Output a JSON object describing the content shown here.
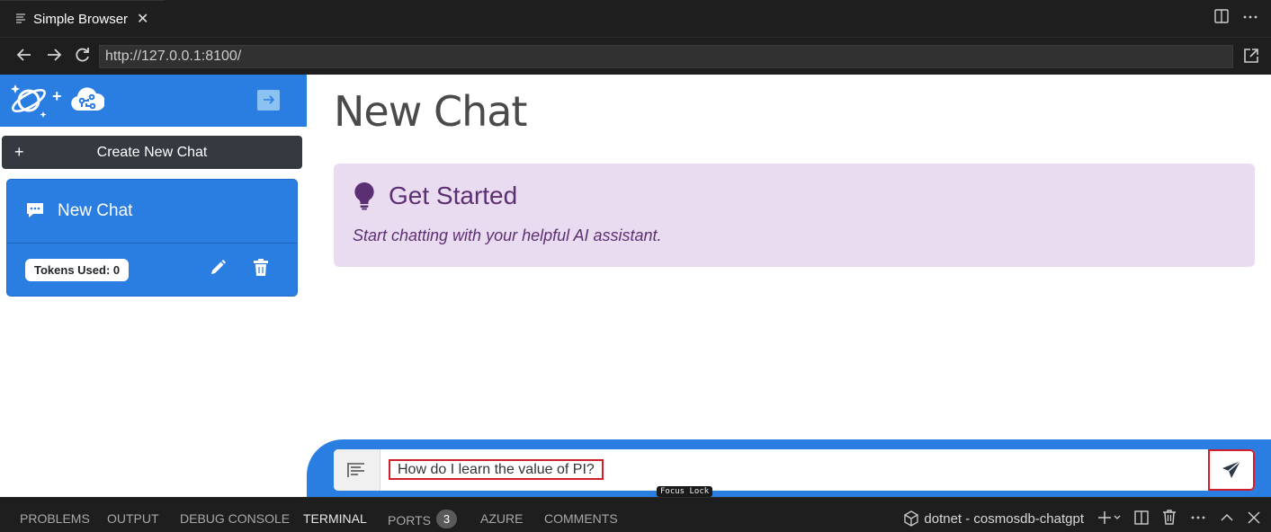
{
  "tab": {
    "title": "Simple Browser",
    "close_glyph": "✕"
  },
  "address": {
    "url": "http://127.0.0.1:8100/"
  },
  "sidebar": {
    "create_button_label": "Create New Chat",
    "chat": {
      "title": "New Chat",
      "tokens_label": "Tokens Used: 0"
    }
  },
  "main": {
    "page_title": "New Chat",
    "alert": {
      "title": "Get Started",
      "text": "Start chatting with your helpful AI assistant."
    },
    "prompt": {
      "value": "How do I learn the value of PI?",
      "tooltip": "Focus Lock"
    }
  },
  "panel": {
    "tabs": [
      "PROBLEMS",
      "OUTPUT",
      "DEBUG CONSOLE",
      "TERMINAL",
      "PORTS",
      "AZURE",
      "COMMENTS"
    ],
    "active_tab": "TERMINAL",
    "ports_badge": "3",
    "terminal_name": "dotnet - cosmosdb-chatgpt"
  },
  "colors": {
    "accent": "#2a7de1",
    "alert_bg": "#eadcf0",
    "alert_text": "#5c2f72",
    "highlight": "#d21d2b",
    "dark_button": "#343a40"
  }
}
